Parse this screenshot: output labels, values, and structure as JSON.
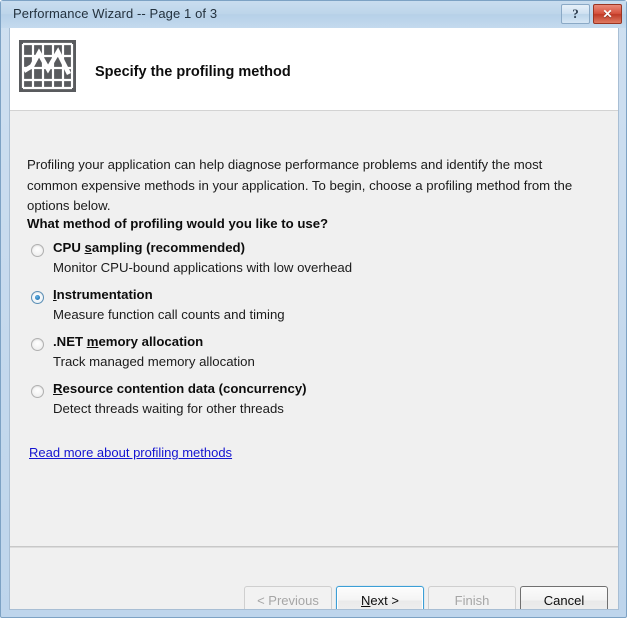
{
  "window": {
    "title": "Performance Wizard -- Page 1 of 3",
    "help_button": "?",
    "close_button": "✕",
    "frame_color": "#c5d9ed",
    "client_bg": "#f0f0f0"
  },
  "header": {
    "icon": "chart-graph-icon",
    "title": "Specify the profiling method"
  },
  "body": {
    "intro": "Profiling your application can help diagnose performance problems and identify the most common expensive methods in your application. To begin, choose a profiling method from the options below.",
    "question": "What method of profiling would you like to use?",
    "options": [
      {
        "id": "cpu-sampling",
        "label_pre": "CPU ",
        "label_accel": "s",
        "label_post": "ampling (recommended)",
        "label_full": "CPU sampling (recommended)",
        "description": "Monitor CPU-bound applications with low overhead",
        "selected": false
      },
      {
        "id": "instrumentation",
        "label_pre": "",
        "label_accel": "I",
        "label_post": "nstrumentation",
        "label_full": "Instrumentation",
        "description": "Measure function call counts and timing",
        "selected": true
      },
      {
        "id": "dotnet-memory-allocation",
        "label_pre": ".NET ",
        "label_accel": "m",
        "label_post": "emory allocation",
        "label_full": ".NET memory allocation",
        "description": "Track managed memory allocation",
        "selected": false
      },
      {
        "id": "resource-contention-data",
        "label_pre": "",
        "label_accel": "R",
        "label_post": "esource contention data (concurrency)",
        "label_full": "Resource contention data (concurrency)",
        "description": "Detect threads waiting for other threads",
        "selected": false
      }
    ],
    "link": "Read more about profiling methods",
    "link_color": "#1414d0"
  },
  "buttons": {
    "previous": {
      "label": "< Previous",
      "enabled": false
    },
    "next": {
      "label_pre": "",
      "label_accel": "N",
      "label_post": "ext >",
      "label_full": "Next >",
      "enabled": true,
      "default": true
    },
    "finish": {
      "label": "Finish",
      "enabled": false
    },
    "cancel": {
      "label": "Cancel",
      "enabled": true
    }
  }
}
